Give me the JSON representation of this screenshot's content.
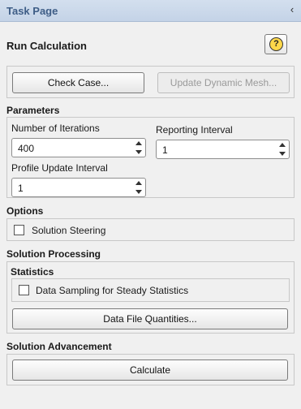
{
  "panel": {
    "title": "Task Page",
    "collapse_glyph": "‹"
  },
  "page": {
    "title": "Run Calculation",
    "help_label": "?"
  },
  "top_buttons": {
    "check_case": "Check Case...",
    "update_mesh": "Update Dynamic Mesh..."
  },
  "parameters": {
    "heading": "Parameters",
    "iterations_label": "Number of Iterations",
    "iterations_value": "400",
    "reporting_label": "Reporting Interval",
    "reporting_value": "1",
    "profile_label": "Profile Update Interval",
    "profile_value": "1"
  },
  "options": {
    "heading": "Options",
    "solution_steering": "Solution Steering",
    "solution_steering_checked": false
  },
  "processing": {
    "heading": "Solution Processing",
    "statistics_heading": "Statistics",
    "data_sampling": "Data Sampling for Steady Statistics",
    "data_sampling_checked": false,
    "data_file_quantities": "Data File Quantities..."
  },
  "advancement": {
    "heading": "Solution Advancement",
    "calculate": "Calculate"
  }
}
